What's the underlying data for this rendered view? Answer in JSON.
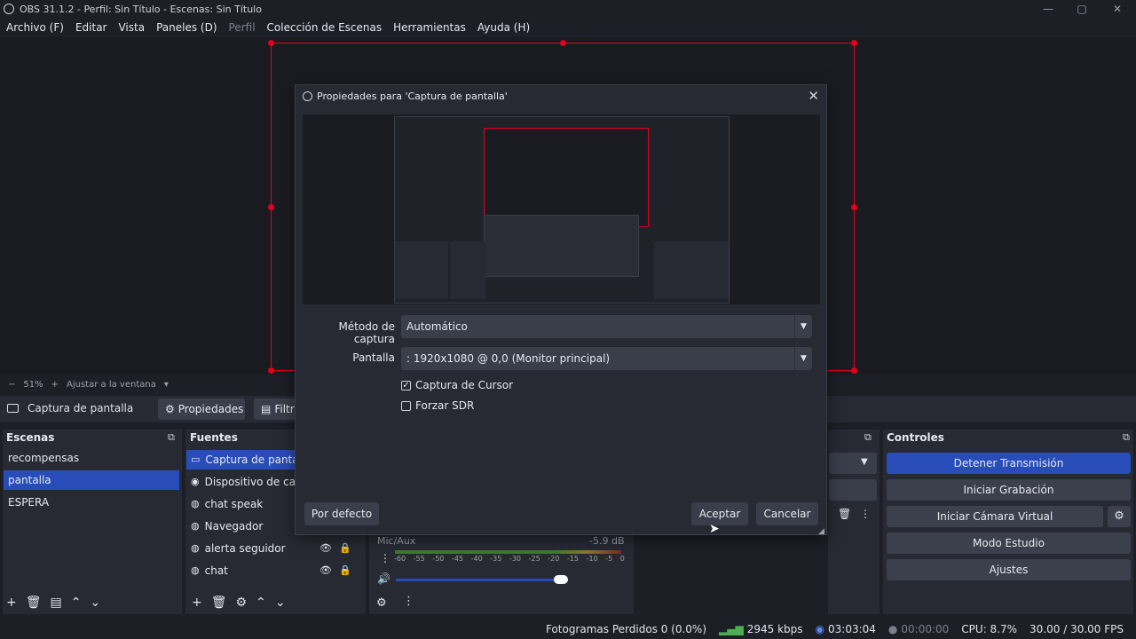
{
  "window": {
    "title": "OBS 31.1.2 - Perfil: Sin Título - Escenas: Sin Título",
    "minimize": "—",
    "maximize": "▢",
    "close": "✕"
  },
  "menu": {
    "items": [
      "Archivo (F)",
      "Editar",
      "Vista",
      "Paneles (D)",
      "Perfil",
      "Colección de Escenas",
      "Herramientas",
      "Ayuda (H)"
    ]
  },
  "zoom": {
    "minus": "−",
    "value": "51%",
    "plus": "+",
    "fit": "Ajustar a la ventana",
    "chevron": "▾"
  },
  "source_toolbar": {
    "current_source": "Captura de pantalla",
    "properties": "Propiedades",
    "filters": "Filtros"
  },
  "scenes": {
    "title": "Escenas",
    "items": [
      "recompensas",
      "pantalla",
      "ESPERA"
    ],
    "selected_index": 1
  },
  "sources": {
    "title": "Fuentes",
    "items": [
      {
        "label": "Captura de pantalla",
        "icon": "monitor-icon"
      },
      {
        "label": "Dispositivo de captura",
        "icon": "camera-icon"
      },
      {
        "label": "chat speak",
        "icon": "globe-icon"
      },
      {
        "label": "Navegador",
        "icon": "globe-icon"
      },
      {
        "label": "alerta seguidor",
        "icon": "globe-icon"
      },
      {
        "label": "chat",
        "icon": "globe-icon"
      }
    ]
  },
  "mixer": {
    "channel": "Mic/Aux",
    "level": "-5.9 dB",
    "scale": [
      "-60",
      "-55",
      "-50",
      "-45",
      "-40",
      "-35",
      "-30",
      "-25",
      "-20",
      "-15",
      "-10",
      "-5",
      "0"
    ]
  },
  "controls": {
    "title": "Controles",
    "stop_stream": "Detener Transmisión",
    "start_recording": "Iniciar Grabación",
    "start_virtual_cam": "Iniciar Cámara Virtual",
    "studio_mode": "Modo Estudio",
    "settings": "Ajustes"
  },
  "status": {
    "dropped_frames": "Fotogramas Perdidos 0 (0.0%)",
    "bitrate": "2945 kbps",
    "stream_time": "03:03:04",
    "record_time": "00:00:00",
    "cpu": "CPU: 8.7%",
    "fps": "30.00 / 30.00 FPS"
  },
  "dialog": {
    "title": "Propiedades para 'Captura de pantalla'",
    "close": "✕",
    "capture_method_label": "Método de captura",
    "capture_method_value": "Automático",
    "display_label": "Pantalla",
    "display_value": ": 1920x1080 @ 0,0 (Monitor principal)",
    "capture_cursor_label": "Captura de Cursor",
    "capture_cursor_checked": true,
    "force_sdr_label": "Forzar SDR",
    "force_sdr_checked": false,
    "defaults_button": "Por defecto",
    "accept_button": "Aceptar",
    "cancel_button": "Cancelar"
  },
  "colors": {
    "accent": "#284cb8",
    "selection_red": "#e3001b",
    "background": "#1d1f26",
    "panel": "#272a33"
  }
}
